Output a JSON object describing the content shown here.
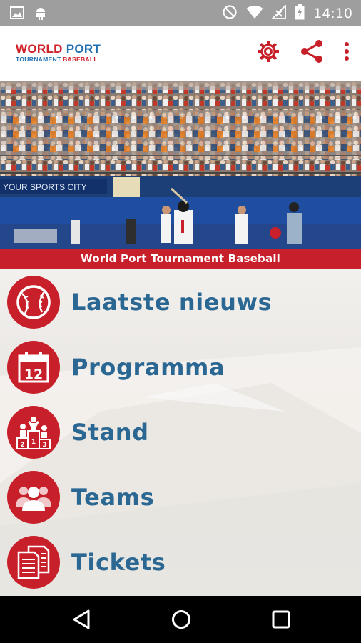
{
  "status_bar": {
    "time": "14:10",
    "icons": [
      "image-icon",
      "android-icon",
      "do-not-disturb-icon",
      "wifi-icon",
      "signal-icon",
      "battery-charging-icon"
    ]
  },
  "app_bar": {
    "logo_line1_a": "WORLD",
    "logo_line1_b": "PORT",
    "logo_line2_a": "TOURNAMENT",
    "logo_line2_b": "BASEBALL",
    "actions": [
      "settings-icon",
      "share-icon",
      "more-vert-icon"
    ]
  },
  "hero": {
    "banner_text": "World Port Tournament Baseball",
    "signage_text": "YOUR SPORTS CITY"
  },
  "menu": {
    "items": [
      {
        "label": "Laatste nieuws",
        "icon": "baseball-icon"
      },
      {
        "label": "Programma",
        "icon": "calendar-icon",
        "icon_text": "12"
      },
      {
        "label": "Stand",
        "icon": "podium-icon",
        "podium_numbers": [
          "2",
          "1",
          "3"
        ]
      },
      {
        "label": "Teams",
        "icon": "team-icon"
      },
      {
        "label": "Tickets",
        "icon": "documents-icon"
      }
    ]
  },
  "colors": {
    "brand_red": "#c8202a",
    "brand_blue": "#2a6792",
    "status_bar": "#9e9e9e"
  },
  "nav_bar": {
    "buttons": [
      "back-icon",
      "home-icon",
      "recents-icon"
    ]
  }
}
